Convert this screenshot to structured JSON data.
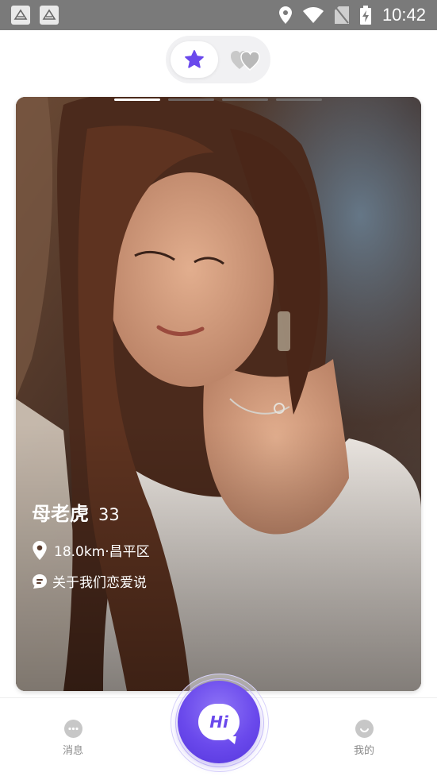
{
  "status_bar": {
    "time": "10:42",
    "icons": [
      "notification-app-icon",
      "notification-app-icon",
      "location-icon",
      "wifi-icon",
      "no-sim-icon",
      "battery-charging-icon"
    ]
  },
  "segment": {
    "active_icon": "star-icon",
    "inactive_icon": "hearts-icon",
    "accent_color": "#6a49ec"
  },
  "card": {
    "page_indicators": {
      "count": 4,
      "active_index": 0
    },
    "name": "母老虎",
    "age": "33",
    "location": "18.0km·昌平区",
    "description": "关于我们恋爱说"
  },
  "tabbar": {
    "messages_label": "消息",
    "hi_label": "Hi",
    "mine_label": "我的"
  }
}
